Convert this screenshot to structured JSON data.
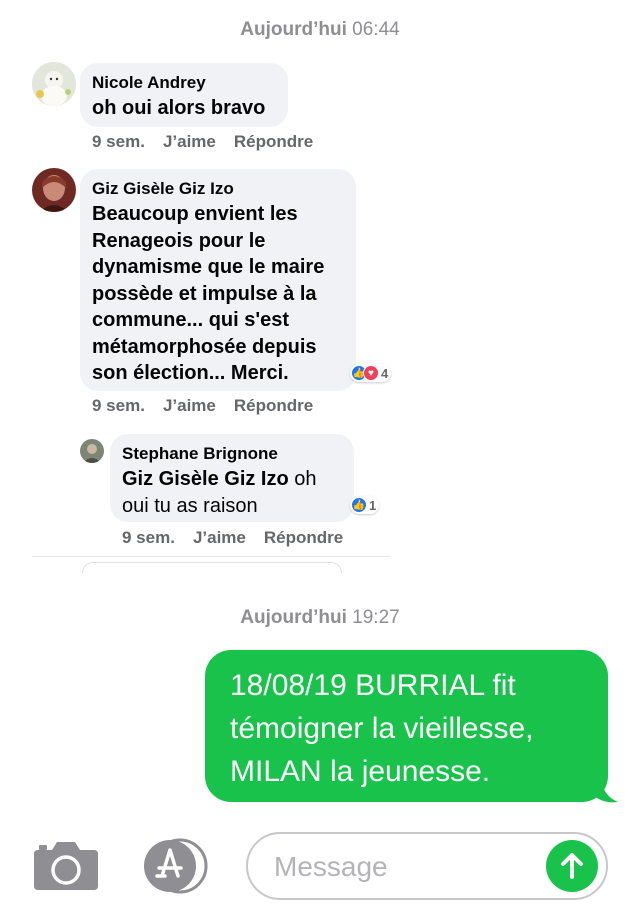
{
  "timestamp1": {
    "day": "Aujourd’hui",
    "time": "06:44"
  },
  "timestamp2": {
    "day": "Aujourd’hui",
    "time": "19:27"
  },
  "comments": [
    {
      "name": "Nicole Andrey",
      "lines": [
        "oh oui alors bravo"
      ],
      "age": "9 sem.",
      "like": "J’aime",
      "reply": "Répondre"
    },
    {
      "name": "Giz Gisèle Giz Izo",
      "lines": [
        "Beaucoup envient les",
        "Renageois pour le",
        "dynamisme que le maire",
        "possède et impulse à la",
        "commune... qui s'est",
        "métamorphosée depuis",
        "son élection... Merci."
      ],
      "reaction_count": "4",
      "age": "9 sem.",
      "like": "J’aime",
      "reply": "Répondre"
    },
    {
      "name": "Stephane Brignone",
      "mention": "Giz Gisèle Giz Izo",
      "line1_rest": " oh",
      "line2": "oui tu as raison",
      "reaction_count": "1",
      "age": "9 sem.",
      "like": "J’aime",
      "reply": "Répondre"
    }
  ],
  "message": {
    "lines": [
      "18/08/19 BURRIAL fit",
      "témoigner la vieillesse,",
      "MILAN la jeunesse."
    ]
  },
  "input": {
    "placeholder": "Message"
  },
  "icons": {
    "camera": "camera-icon",
    "appstore": "app-store-icon",
    "send": "arrow-up-icon"
  },
  "colors": {
    "imessage_green": "#19c24b",
    "fb_bubble": "#f0f2f5",
    "like_blue": "#1877f2",
    "love_red": "#f33e58"
  }
}
